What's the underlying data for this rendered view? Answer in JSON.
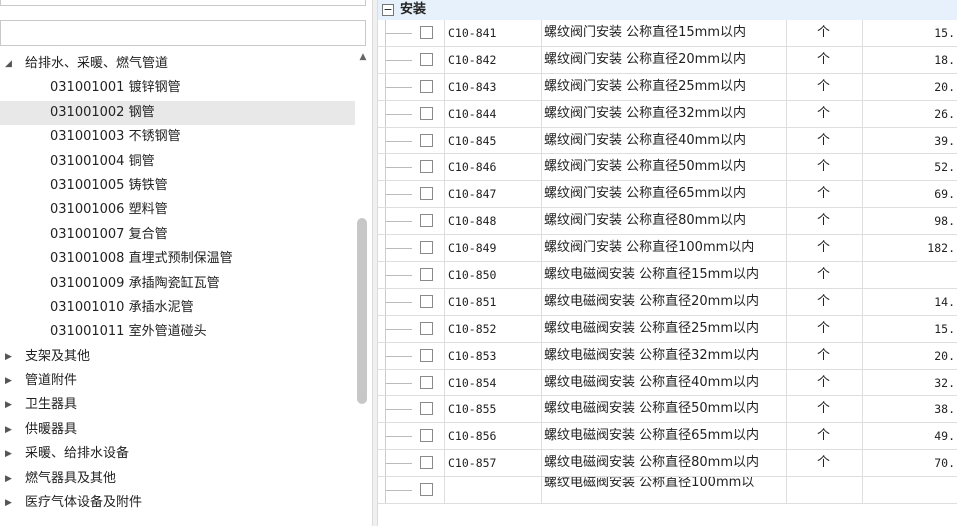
{
  "tree": {
    "nodes": [
      {
        "label": "给排水、采暖、燃气管道",
        "toggle": "◢",
        "child": false
      },
      {
        "label": "031001001  镀锌钢管",
        "toggle": "",
        "child": true
      },
      {
        "label": "031001002  钢管",
        "toggle": "",
        "child": true
      },
      {
        "label": "031001003  不锈钢管",
        "toggle": "",
        "child": true
      },
      {
        "label": "031001004  铜管",
        "toggle": "",
        "child": true
      },
      {
        "label": "031001005  铸铁管",
        "toggle": "",
        "child": true
      },
      {
        "label": "031001006  塑料管",
        "toggle": "",
        "child": true
      },
      {
        "label": "031001007  复合管",
        "toggle": "",
        "child": true
      },
      {
        "label": "031001008  直埋式预制保温管",
        "toggle": "",
        "child": true
      },
      {
        "label": "031001009  承插陶瓷缸瓦管",
        "toggle": "",
        "child": true
      },
      {
        "label": "031001010  承插水泥管",
        "toggle": "",
        "child": true
      },
      {
        "label": "031001011  室外管道碰头",
        "toggle": "",
        "child": true
      },
      {
        "label": "支架及其他",
        "toggle": "▶",
        "child": false
      },
      {
        "label": "管道附件",
        "toggle": "▶",
        "child": false
      },
      {
        "label": "卫生器具",
        "toggle": "▶",
        "child": false
      },
      {
        "label": "供暖器具",
        "toggle": "▶",
        "child": false
      },
      {
        "label": "采暖、给排水设备",
        "toggle": "▶",
        "child": false
      },
      {
        "label": "燃气器具及其他",
        "toggle": "▶",
        "child": false
      },
      {
        "label": "医疗气体设备及附件",
        "toggle": "▶",
        "child": false
      }
    ],
    "selected_index": 2
  },
  "group": {
    "label": "安装",
    "toggle": "−"
  },
  "rows": [
    {
      "code": "C10-841",
      "name": "螺纹阀门安装 公称直径15mm以内",
      "unit": "个",
      "value": "15."
    },
    {
      "code": "C10-842",
      "name": "螺纹阀门安装 公称直径20mm以内",
      "unit": "个",
      "value": "18."
    },
    {
      "code": "C10-843",
      "name": "螺纹阀门安装 公称直径25mm以内",
      "unit": "个",
      "value": "20."
    },
    {
      "code": "C10-844",
      "name": "螺纹阀门安装 公称直径32mm以内",
      "unit": "个",
      "value": "26."
    },
    {
      "code": "C10-845",
      "name": "螺纹阀门安装 公称直径40mm以内",
      "unit": "个",
      "value": "39."
    },
    {
      "code": "C10-846",
      "name": "螺纹阀门安装 公称直径50mm以内",
      "unit": "个",
      "value": "52."
    },
    {
      "code": "C10-847",
      "name": "螺纹阀门安装 公称直径65mm以内",
      "unit": "个",
      "value": "69."
    },
    {
      "code": "C10-848",
      "name": "螺纹阀门安装 公称直径80mm以内",
      "unit": "个",
      "value": "98."
    },
    {
      "code": "C10-849",
      "name": "螺纹阀门安装 公称直径100mm以内",
      "unit": "个",
      "value": "182."
    },
    {
      "code": "C10-850",
      "name": "螺纹电磁阀安装 公称直径15mm以内",
      "unit": "个",
      "value": ""
    },
    {
      "code": "C10-851",
      "name": "螺纹电磁阀安装 公称直径20mm以内",
      "unit": "个",
      "value": "14."
    },
    {
      "code": "C10-852",
      "name": "螺纹电磁阀安装 公称直径25mm以内",
      "unit": "个",
      "value": "15."
    },
    {
      "code": "C10-853",
      "name": "螺纹电磁阀安装 公称直径32mm以内",
      "unit": "个",
      "value": "20."
    },
    {
      "code": "C10-854",
      "name": "螺纹电磁阀安装 公称直径40mm以内",
      "unit": "个",
      "value": "32."
    },
    {
      "code": "C10-855",
      "name": "螺纹电磁阀安装 公称直径50mm以内",
      "unit": "个",
      "value": "38."
    },
    {
      "code": "C10-856",
      "name": "螺纹电磁阀安装 公称直径65mm以内",
      "unit": "个",
      "value": "49."
    },
    {
      "code": "C10-857",
      "name": "螺纹电磁阀安装 公称直径80mm以内",
      "unit": "个",
      "value": "70."
    },
    {
      "code": "",
      "name": "螺纹电磁阀安装 公称直径100mm以",
      "unit": "",
      "value": ""
    }
  ],
  "colors": {
    "selected_bg": "#e8e8e8",
    "header_bg": "#e6f1fb",
    "grid": "#dedede"
  }
}
